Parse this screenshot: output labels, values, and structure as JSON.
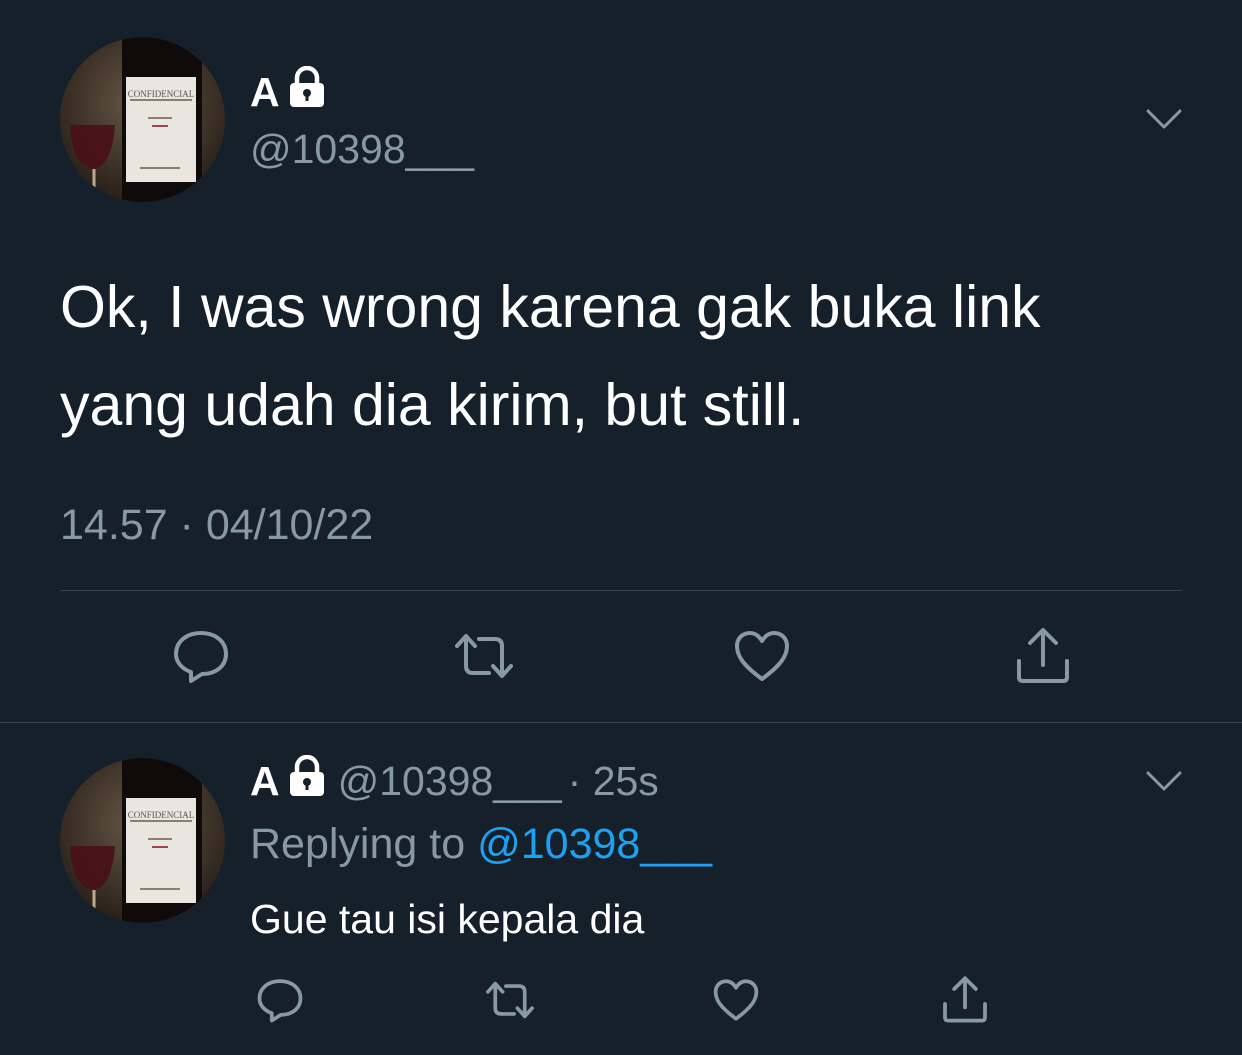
{
  "main_tweet": {
    "display_name": "A",
    "handle": "@10398___",
    "text_line1": "Ok, I was wrong karena gak buka link",
    "text_line2": "yang udah dia kirim, but still.",
    "timestamp": "14.57 · 04/10/22"
  },
  "reply_tweet": {
    "display_name": "A",
    "handle": "@10398___",
    "time_ago": "· 25s",
    "replying_prefix": "Replying to",
    "replying_to": "@10398___",
    "text": "Gue tau isi kepala dia"
  },
  "avatar_label": "CONFIDENCIAL",
  "icons": {
    "lock": "lock-icon",
    "chevron": "chevron-down-icon",
    "reply": "reply-icon",
    "retweet": "retweet-icon",
    "like": "heart-icon",
    "share": "share-icon"
  },
  "colors": {
    "background": "#15202b",
    "text": "#ffffff",
    "muted": "#8899a6",
    "link": "#1da1f2",
    "divider": "#38444d"
  }
}
